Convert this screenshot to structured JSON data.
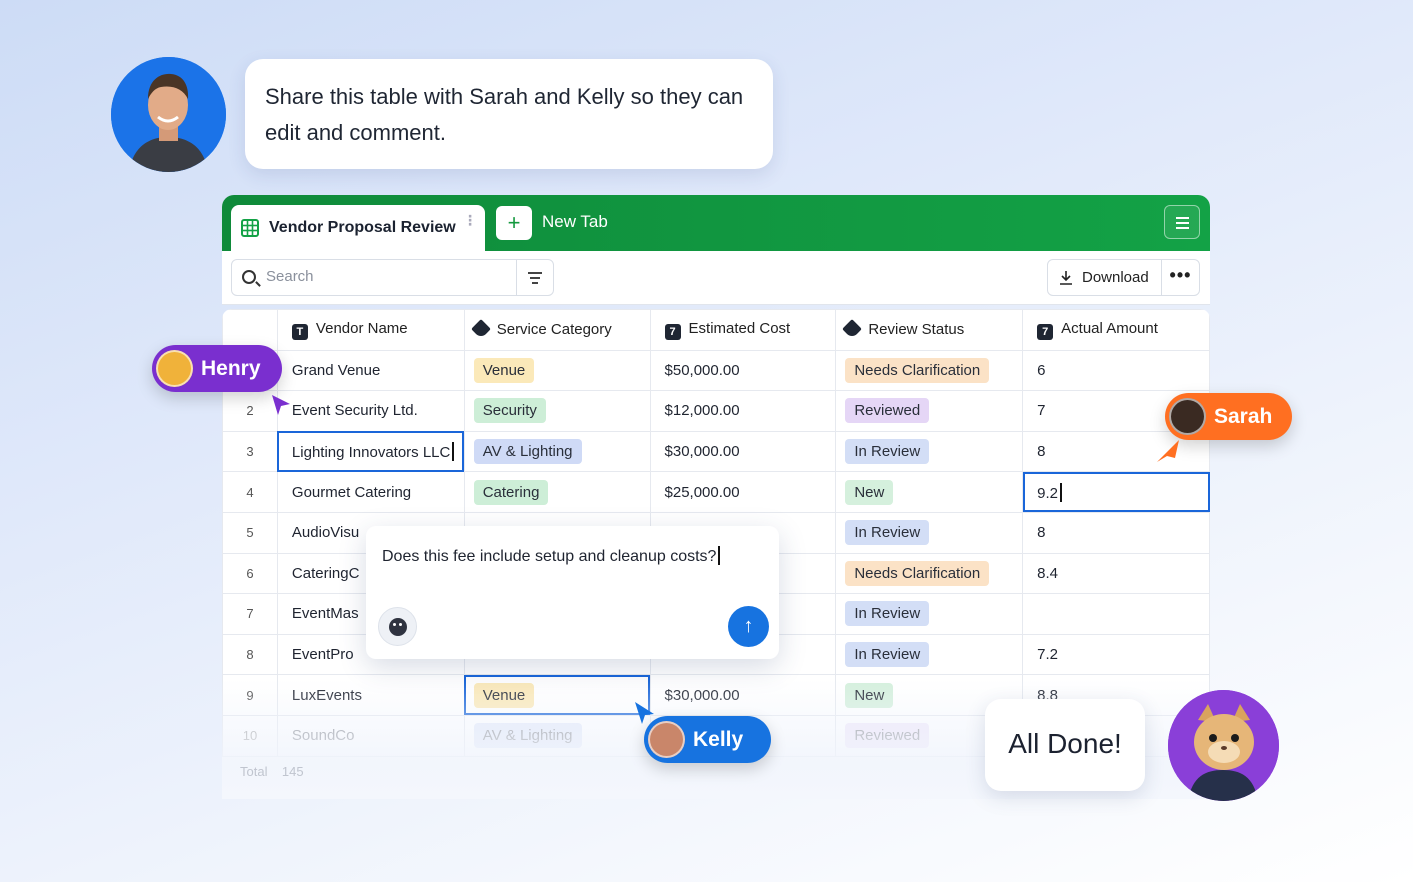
{
  "prompt": {
    "text": "Share this table with Sarah and Kelly so they can edit and comment."
  },
  "tabs": {
    "active_label": "Vendor Proposal Review",
    "new_tab_label": "New Tab",
    "add_symbol": "+"
  },
  "toolbar": {
    "search_placeholder": "Search",
    "download_label": "Download",
    "more_label": "•••"
  },
  "columns": [
    "Vendor Name",
    "Service Category",
    "Estimated Cost",
    "Review Status",
    "Actual Amount"
  ],
  "column_icons": [
    "text-type-icon",
    "tag-icon",
    "number-type-icon",
    "tag-icon",
    "number-type-icon"
  ],
  "rows": [
    {
      "n": "",
      "vendor": "Grand Venue",
      "category": "Venue",
      "cost": "$50,000.00",
      "status": "Needs Clarification",
      "actual": "6"
    },
    {
      "n": "2",
      "vendor": "Event Security Ltd.",
      "category": "Security",
      "cost": "$12,000.00",
      "status": "Reviewed",
      "actual": "7"
    },
    {
      "n": "3",
      "vendor": "Lighting Innovators LLC",
      "category": "AV & Lighting",
      "cost": "$30,000.00",
      "status": "In Review",
      "actual": "8"
    },
    {
      "n": "4",
      "vendor": "Gourmet Catering",
      "category": "Catering",
      "cost": "$25,000.00",
      "status": "New",
      "actual": "9.2"
    },
    {
      "n": "5",
      "vendor": "AudioVisu",
      "category": "",
      "cost": "",
      "status": "In Review",
      "actual": "8"
    },
    {
      "n": "6",
      "vendor": "CateringC",
      "category": "",
      "cost": "",
      "status": "Needs Clarification",
      "actual": "8.4"
    },
    {
      "n": "7",
      "vendor": "EventMas",
      "category": "",
      "cost": "",
      "status": "In Review",
      "actual": ""
    },
    {
      "n": "8",
      "vendor": "EventPro",
      "category": "",
      "cost": "",
      "status": "In Review",
      "actual": "7.2"
    },
    {
      "n": "9",
      "vendor": "LuxEvents",
      "category": "Venue",
      "cost": "$30,000.00",
      "status": "New",
      "actual": "8.8"
    },
    {
      "n": "10",
      "vendor": "SoundCo",
      "category": "AV & Lighting",
      "cost": "",
      "status": "Reviewed",
      "actual": ""
    }
  ],
  "footer": {
    "total_label": "Total",
    "total_value": "145"
  },
  "comment": {
    "text": "Does this fee include setup and cleanup costs?",
    "send_symbol": "↑"
  },
  "collaborators": {
    "henry": "Henry",
    "sarah": "Sarah",
    "kelly": "Kelly"
  },
  "done_message": "All Done!",
  "colors": {
    "green_bar": "#13a246",
    "henry": "#7a2fcf",
    "sarah": "#ff6f21",
    "kelly": "#1773e0",
    "selection": "#1a66d9"
  }
}
